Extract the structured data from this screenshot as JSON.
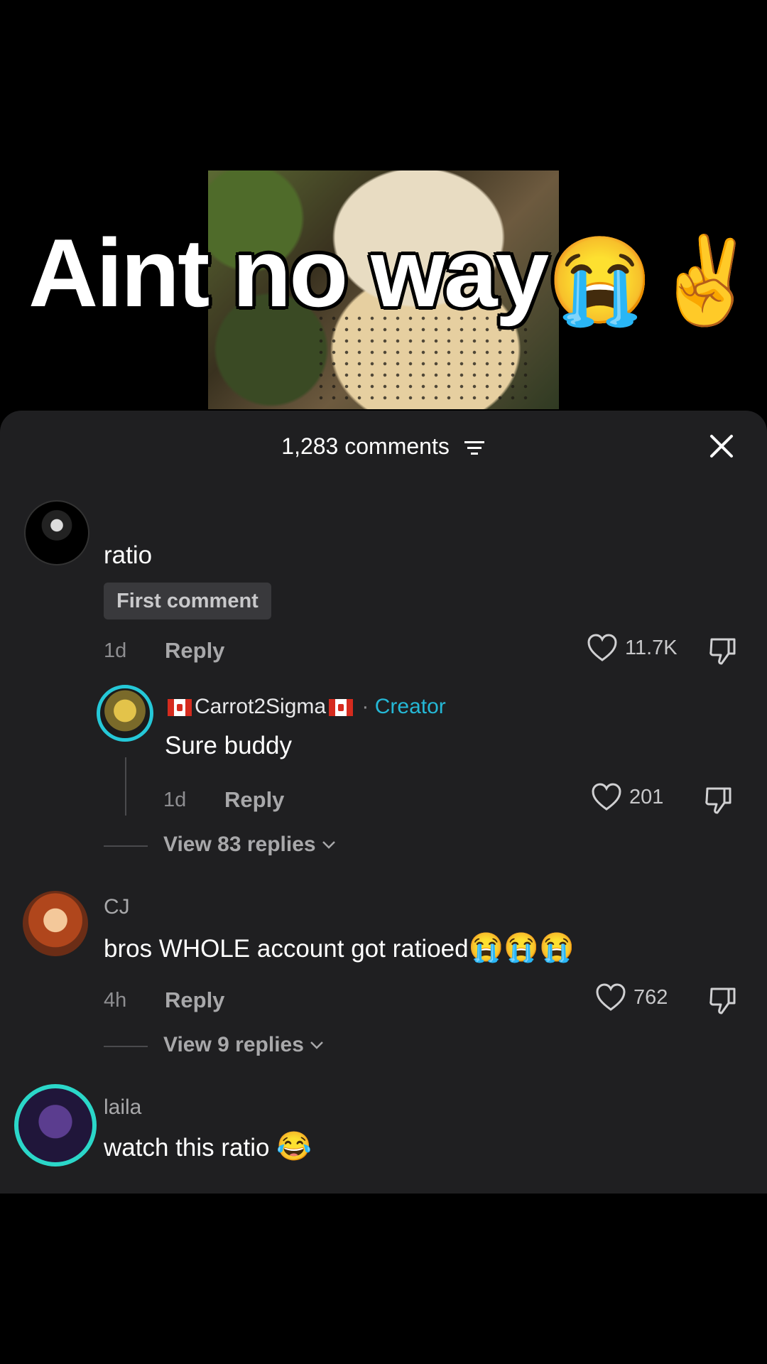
{
  "video": {
    "caption_text": "Aint no way",
    "caption_emojis": [
      "😭",
      "✌️"
    ]
  },
  "sheet": {
    "comment_count_label": "1,283 comments",
    "close_icon": "close-icon",
    "filter_icon": "filter-icon"
  },
  "comments": [
    {
      "username": "",
      "text": "ratio",
      "badge": "First comment",
      "time": "1d",
      "reply_label": "Reply",
      "likes": "11.7K",
      "view_replies": "View 83 replies",
      "reply": {
        "username": "Carrot2Sigma",
        "separator": "·",
        "creator_label": "Creator",
        "text": "Sure buddy",
        "time": "1d",
        "reply_label": "Reply",
        "likes": "201"
      }
    },
    {
      "username": "CJ",
      "text": "bros WHOLE account got ratioed",
      "text_emojis": "😭😭😭",
      "time": "4h",
      "reply_label": "Reply",
      "likes": "762",
      "view_replies": "View 9 replies"
    },
    {
      "username": "laila",
      "text": "watch this ratio",
      "text_emojis": "😂"
    }
  ],
  "colors": {
    "sheet_bg": "#1f1f21",
    "creator_accent": "#25b8d6",
    "avatar_ring": "#2bd7c9"
  }
}
